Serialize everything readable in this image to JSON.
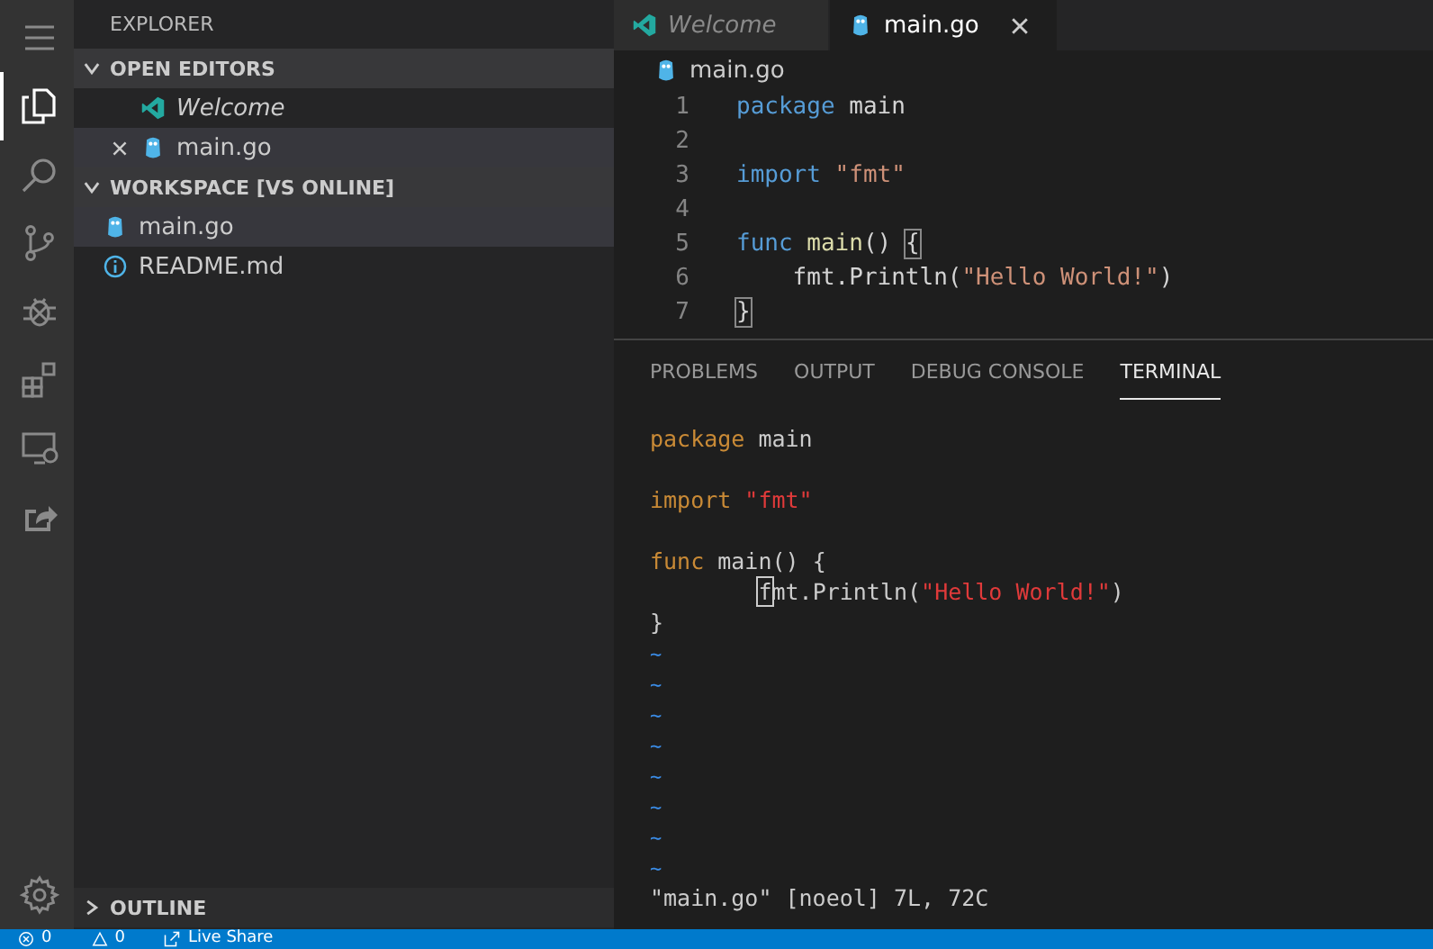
{
  "activity_bar": [
    {
      "kind": "menu",
      "selected": false
    },
    {
      "kind": "files",
      "selected": true
    },
    {
      "kind": "search",
      "selected": false
    },
    {
      "kind": "branch",
      "selected": false
    },
    {
      "kind": "bug",
      "selected": false
    },
    {
      "kind": "extensions",
      "selected": false
    },
    {
      "kind": "remote",
      "selected": false
    },
    {
      "kind": "share",
      "selected": false
    },
    {
      "kind": "gear",
      "selected": false
    }
  ],
  "sidebar": {
    "title": "EXPLORER",
    "sections": [
      {
        "title": "OPEN EDITORS",
        "expanded": true,
        "items": [
          {
            "label": "Welcome",
            "kind": "vscode",
            "preview": true,
            "selected": false,
            "show_close": false
          },
          {
            "label": "main.go",
            "kind": "gopher",
            "preview": false,
            "selected": true,
            "show_close": true
          }
        ]
      },
      {
        "title": "WORKSPACE [VS ONLINE]",
        "expanded": true,
        "items": [
          {
            "label": "main.go",
            "kind": "gopher",
            "selected": true
          },
          {
            "label": "README.md",
            "kind": "info",
            "selected": false
          }
        ]
      }
    ],
    "outline": {
      "title": "OUTLINE",
      "expanded": false
    }
  },
  "editor": {
    "tabs": [
      {
        "label": "Welcome",
        "kind": "vscode",
        "preview": true,
        "selected": false
      },
      {
        "label": "main.go",
        "kind": "gopher",
        "preview": false,
        "selected": true
      }
    ],
    "breadcrumb": "main.go",
    "lines": [
      {
        "number": "1",
        "tokens": [
          {
            "text": "package",
            "kind": "keyword"
          },
          {
            "text": " main",
            "kind": "plain"
          }
        ]
      },
      {
        "number": "2"
      },
      {
        "number": "3",
        "tokens": [
          {
            "text": "import",
            "kind": "keyword"
          },
          {
            "text": " \"fmt\"",
            "kind": "string"
          }
        ]
      },
      {
        "number": "4"
      },
      {
        "number": "5",
        "tokens": [
          {
            "text": "func",
            "kind": "keyword"
          },
          {
            "text": " main",
            "kind": "function"
          },
          {
            "text": "() ",
            "kind": "plain"
          },
          {
            "text": "{",
            "kind": "bracket"
          }
        ]
      },
      {
        "number": "6",
        "tokens": [
          {
            "text": "    fmt.Println(",
            "kind": "plain"
          },
          {
            "text": "\"Hello World!\"",
            "kind": "string"
          },
          {
            "text": ")",
            "kind": "plain"
          }
        ]
      },
      {
        "number": "7",
        "tokens": [
          {
            "text": "}",
            "kind": "bracket"
          }
        ]
      }
    ]
  },
  "panel": {
    "tabs": [
      {
        "label": "PROBLEMS",
        "selected": false
      },
      {
        "label": "OUTPUT",
        "selected": false
      },
      {
        "label": "DEBUG CONSOLE",
        "selected": false
      },
      {
        "label": "TERMINAL",
        "selected": true
      }
    ],
    "terminal_lines": [
      {
        "tokens": [
          {
            "text": "package",
            "kind": "keyword"
          },
          {
            "text": " main",
            "kind": "plain"
          }
        ]
      },
      {
        "kind": "blank"
      },
      {
        "tokens": [
          {
            "text": "import",
            "kind": "keyword"
          },
          {
            "text": " \"fmt\"",
            "kind": "string"
          }
        ]
      },
      {
        "kind": "blank"
      },
      {
        "tokens": [
          {
            "text": "func",
            "kind": "keyword"
          },
          {
            "text": " main() {",
            "kind": "plain"
          }
        ]
      },
      {
        "tokens": [
          {
            "text": "        f",
            "kind": "cursor"
          },
          {
            "text": "mt.Println(",
            "kind": "plain"
          },
          {
            "text": "\"Hello World!\"",
            "kind": "string"
          },
          {
            "text": ")",
            "kind": "plain"
          }
        ]
      },
      {
        "tokens": [
          {
            "text": "}",
            "kind": "plain"
          }
        ]
      },
      {
        "tokens": [
          {
            "text": "~",
            "kind": "tilde"
          }
        ]
      },
      {
        "tokens": [
          {
            "text": "~",
            "kind": "tilde"
          }
        ]
      },
      {
        "tokens": [
          {
            "text": "~",
            "kind": "tilde"
          }
        ]
      },
      {
        "tokens": [
          {
            "text": "~",
            "kind": "tilde"
          }
        ]
      },
      {
        "tokens": [
          {
            "text": "~",
            "kind": "tilde"
          }
        ]
      },
      {
        "tokens": [
          {
            "text": "~",
            "kind": "tilde"
          }
        ]
      },
      {
        "tokens": [
          {
            "text": "~",
            "kind": "tilde"
          }
        ]
      },
      {
        "tokens": [
          {
            "text": "~",
            "kind": "tilde"
          }
        ]
      },
      {
        "tokens": [
          {
            "text": "\"main.go\" [noeol] 7L, 72C",
            "kind": "plain"
          }
        ]
      }
    ]
  },
  "status_bar": [
    {
      "kind": "errors",
      "text": "0"
    },
    {
      "kind": "warnings",
      "text": "0"
    },
    {
      "kind": "liveshare",
      "text": "Live Share"
    }
  ]
}
